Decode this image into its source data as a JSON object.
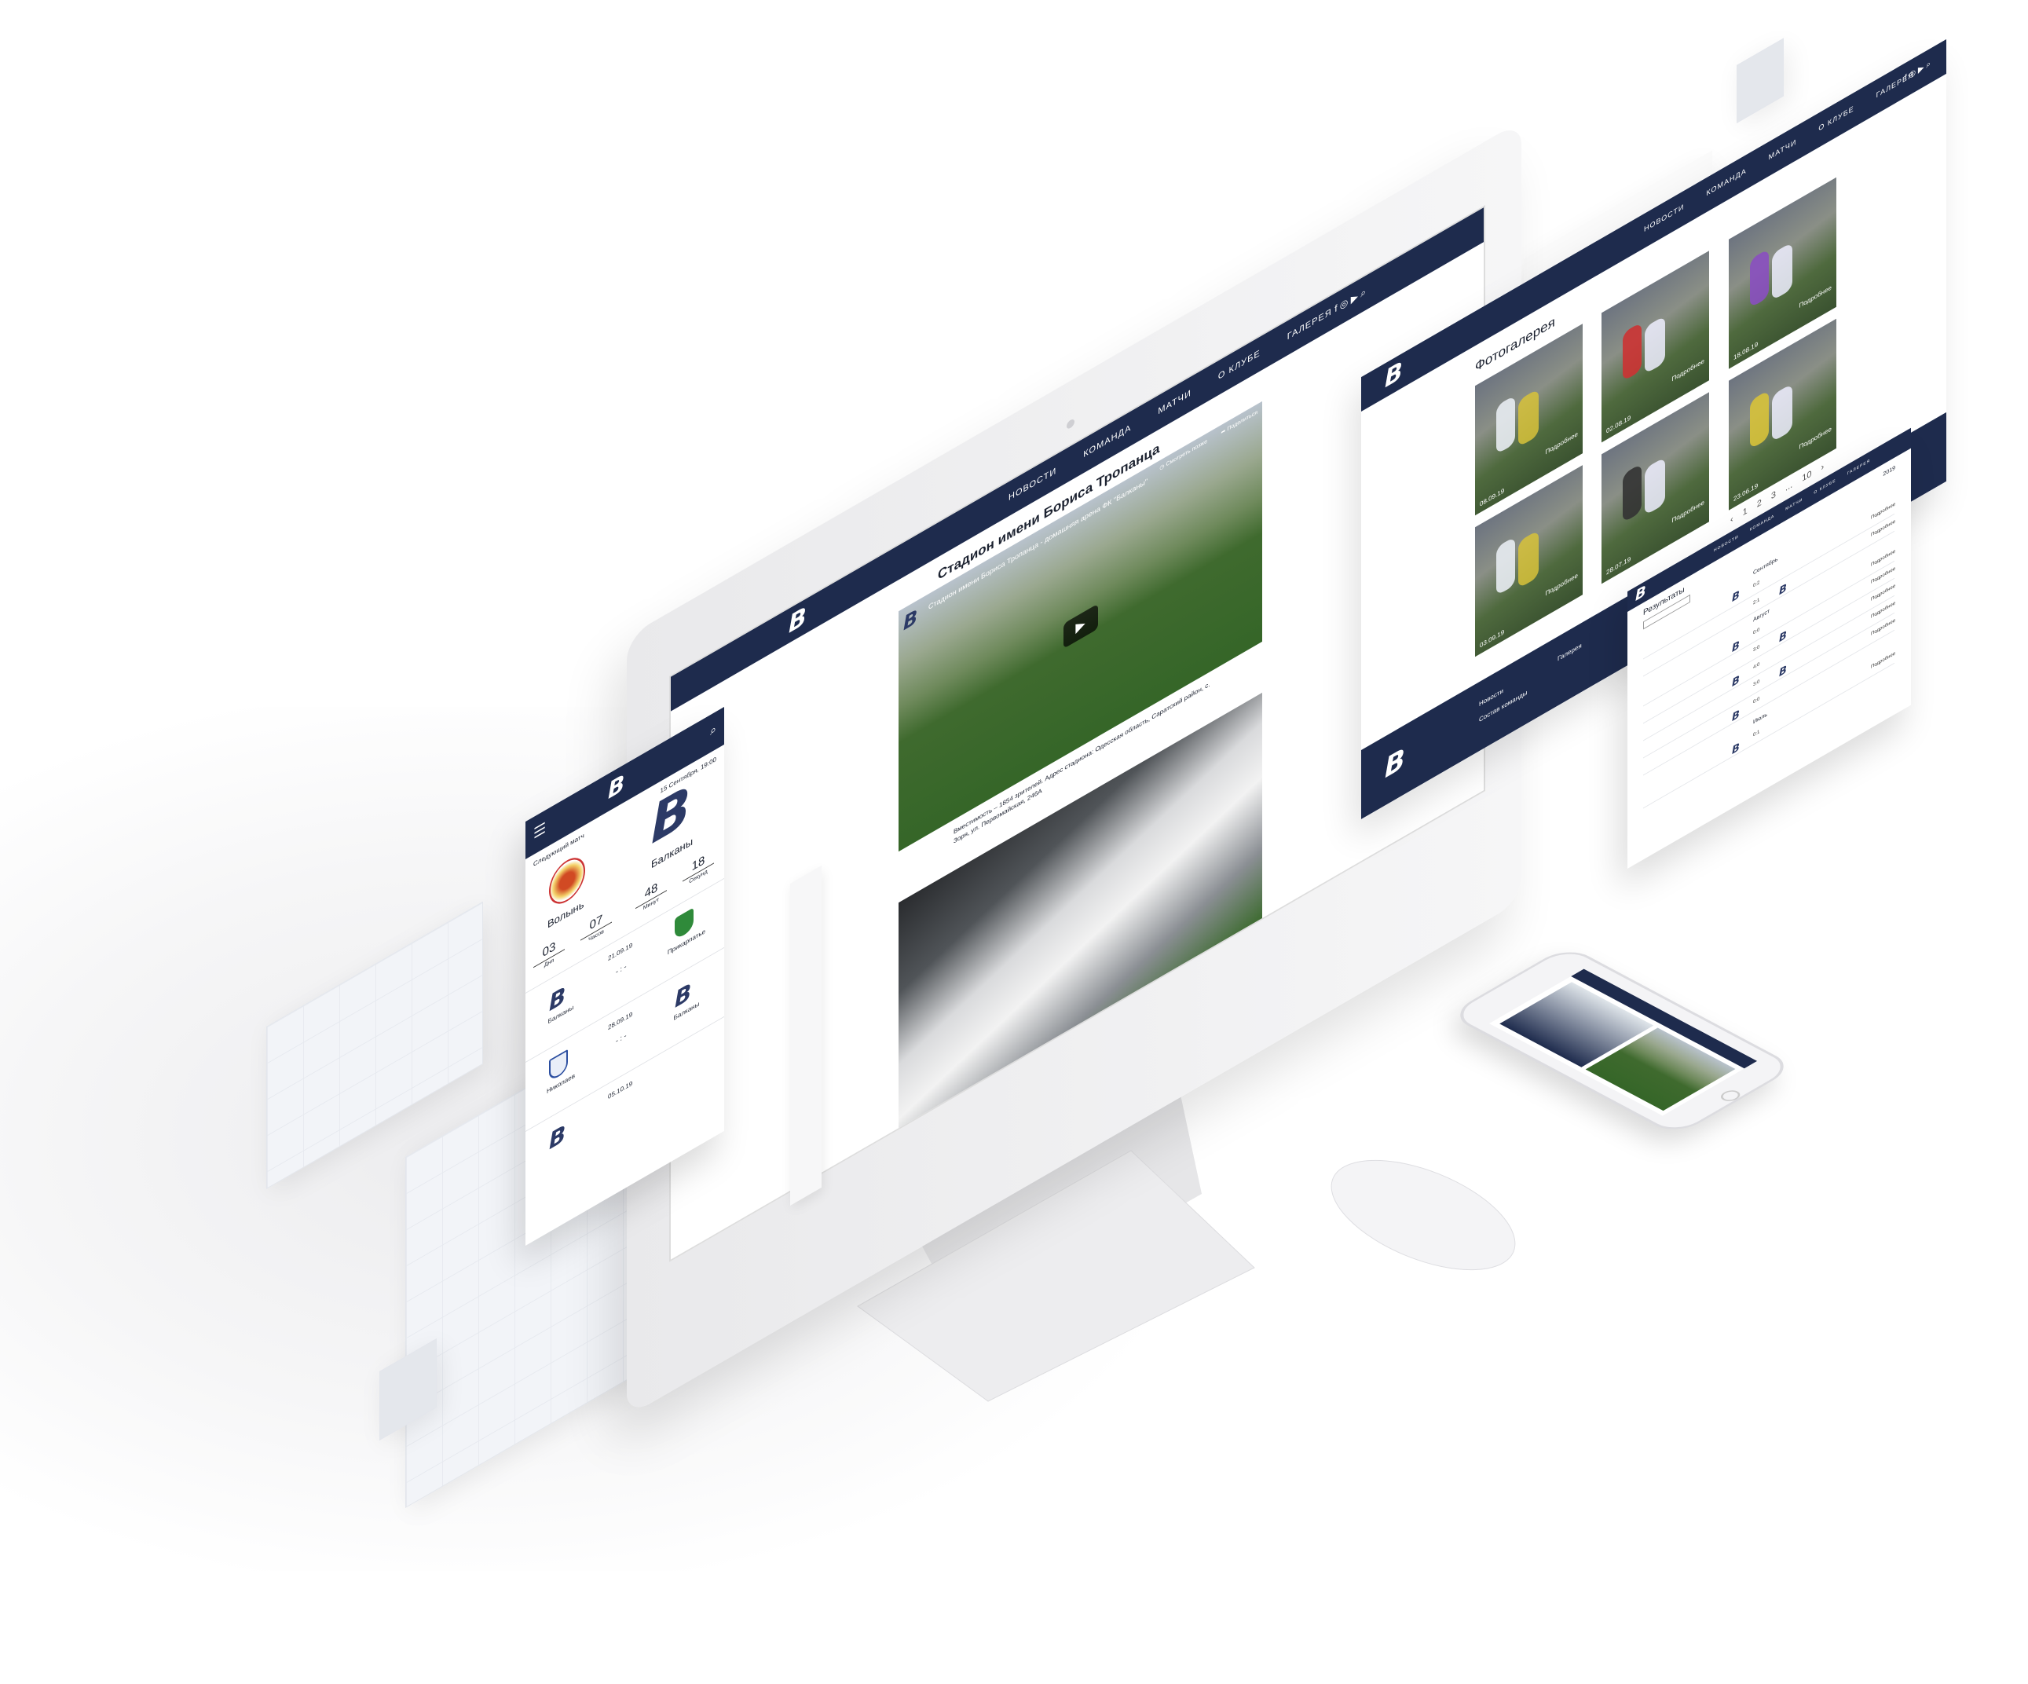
{
  "brand": {
    "logo": "B",
    "logo_sub": "Балканы",
    "navy": "#1e2b4d"
  },
  "nav": [
    "Новости",
    "Команда",
    "Матчи",
    "О клубе",
    "Галерея"
  ],
  "stadium": {
    "title": "Стадион имени Бориса Тропанца",
    "video_title": "Стадион имени Бориса Тропанца - домашняя арена ФК \"Балканы\"",
    "watch_later": "Смотреть позже",
    "share": "Поделиться",
    "caption": "Вместимость – 1854 зрителей. Адрес стадиона: Одесская область, Саратский район, с. Зоря, ул. Первомайская, 246А"
  },
  "mobile": {
    "next_match_label": "Следующий матч",
    "date": "15 Сентября, 19:00",
    "home": "Волынь",
    "away": "Балканы",
    "countdown": [
      {
        "value": "03",
        "label": "Дня"
      },
      {
        "value": "07",
        "label": "Часов"
      },
      {
        "value": "48",
        "label": "Минут"
      },
      {
        "value": "18",
        "label": "Секунд"
      }
    ],
    "fixtures": [
      {
        "date": "21.09.19",
        "score": "- : -",
        "home": "Балканы",
        "away": "Прикарпатье"
      },
      {
        "date": "28.09.19",
        "score": "- : -",
        "home": "Николаев",
        "away": "Балканы"
      },
      {
        "date": "05.10.19",
        "score": "",
        "home": "",
        "away": ""
      }
    ]
  },
  "gallery": {
    "title": "Фотогалерея",
    "more": "Подробнее",
    "photos": [
      {
        "date": "08.09.19"
      },
      {
        "date": "02.08.19"
      },
      {
        "date": "18.08.19"
      },
      {
        "date": "03.09.19"
      },
      {
        "date": "28.07.19"
      },
      {
        "date": "23.06.19"
      }
    ],
    "pagination": [
      "‹",
      "1",
      "2",
      "3",
      "...",
      "10",
      "›"
    ],
    "footer": [
      "Новости",
      "Состав команды",
      "Галерея"
    ]
  },
  "results": {
    "title": "Результаты",
    "year": "2019",
    "details": "Подробнее",
    "months": [
      "Сентябрь",
      "Август",
      "Июль"
    ],
    "scores": [
      "0:2",
      "2:1",
      "0:0",
      "3:0",
      "4:0",
      "3:0",
      "0:0",
      "0:1"
    ]
  },
  "icons": [
    "hamburger-icon",
    "search-icon",
    "play-icon",
    "clock-icon",
    "share-icon",
    "apple-logo-icon"
  ]
}
